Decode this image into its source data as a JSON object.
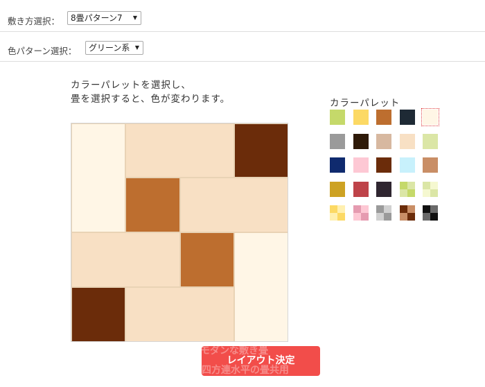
{
  "layout_select": {
    "label": "敷き方選択：",
    "value": "8畳パターン7"
  },
  "color_select": {
    "label": "色パターン選択：",
    "value": "グリーン系"
  },
  "instructions": {
    "line1": "カラーパレットを選択し、",
    "line2": "畳を選択すると、色が変わります。"
  },
  "palette": {
    "title": "カラーパレット",
    "solid_rows": [
      [
        "#c5d96a",
        "#fcd964",
        "#bd6e2f",
        "#1e2a35",
        "#fff6e6"
      ],
      [
        "#9a9a9a",
        "#2e1a08",
        "#d7b8a0",
        "#f8e0c4",
        "#dbe6a6"
      ],
      [
        "#0f2a6e",
        "#fdc8d4",
        "#6b2c0a",
        "#c8f1fc",
        "#c98e66"
      ],
      [
        "#cda223",
        "#be4349",
        "#2f2630"
      ]
    ],
    "checker_swatches": [
      [
        "#c5d96a",
        "#dbe6a6",
        "#dbe6a6",
        "#c5d96a"
      ],
      [
        "#dbe6a6",
        "#f5f8d0",
        "#f5f8d0",
        "#dbe6a6"
      ],
      [
        "#fcd964",
        "#fff0b0",
        "#fff0b0",
        "#fcd964"
      ],
      [
        "#e59bb0",
        "#fdc8d4",
        "#fdc8d4",
        "#e59bb0"
      ],
      [
        "#9a9a9a",
        "#d0d0d0",
        "#d0d0d0",
        "#9a9a9a"
      ],
      [
        "#6b2c0a",
        "#c98e66",
        "#c98e66",
        "#6b2c0a"
      ],
      [
        "#111111",
        "#6a6a6a",
        "#6a6a6a",
        "#111111"
      ]
    ],
    "selected_color": "#fff6e6"
  },
  "tatami": [
    {
      "color": "#fff6e6"
    },
    {
      "color": "#f8e0c4"
    },
    {
      "color": "#6b2c0a"
    },
    {
      "color": "#bd6e2f"
    },
    {
      "color": "#f8e0c4"
    },
    {
      "color": "#f8e0c4"
    },
    {
      "color": "#bd6e2f"
    },
    {
      "color": "#fff6e6"
    },
    {
      "color": "#6b2c0a"
    },
    {
      "color": "#f8e0c4"
    }
  ],
  "decide_button": {
    "label": "レイアウト決定",
    "ghost_line1": "モダンな敷き畳",
    "ghost_line2": "四方連水平の畳共用"
  }
}
